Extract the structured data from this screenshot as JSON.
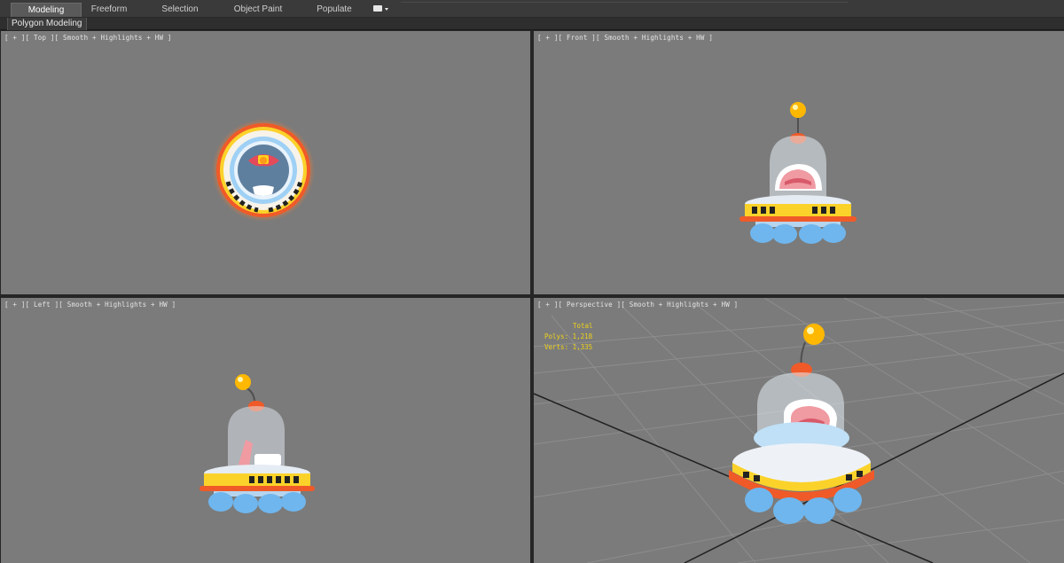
{
  "ribbon": {
    "tabs": [
      {
        "label": "Modeling",
        "active": true
      },
      {
        "label": "Freeform",
        "active": false
      },
      {
        "label": "Selection",
        "active": false
      },
      {
        "label": "Object Paint",
        "active": false
      },
      {
        "label": "Populate",
        "active": false
      }
    ],
    "dropdown_icon": "menu-dropdown-icon",
    "panel_label": "Polygon Modeling"
  },
  "viewports": {
    "top": {
      "label": "[ + ][ Top ][ Smooth + Highlights + HW ]"
    },
    "front": {
      "label": "[ + ][ Front ][ Smooth + Highlights + HW ]"
    },
    "left": {
      "label": "[ + ][ Left ][ Smooth + Highlights + HW ]"
    },
    "perspective": {
      "label": "[ + ][ Perspective ][ Smooth + Highlights + HW ]",
      "stats": {
        "header": "Total",
        "polys_label": "Polys:",
        "polys_value": "1,218",
        "verts_label": "Verts:",
        "verts_value": "1,335"
      }
    }
  },
  "colors": {
    "viewport_bg": "#7b7b7b",
    "stats_text": "#f0d21a",
    "ufo_orange": "#f26a2a",
    "ufo_yellow": "#f7c51e",
    "ufo_blue": "#6fb6ee",
    "ufo_white": "#eef2f7",
    "antenna_ball": "#ffb800"
  }
}
